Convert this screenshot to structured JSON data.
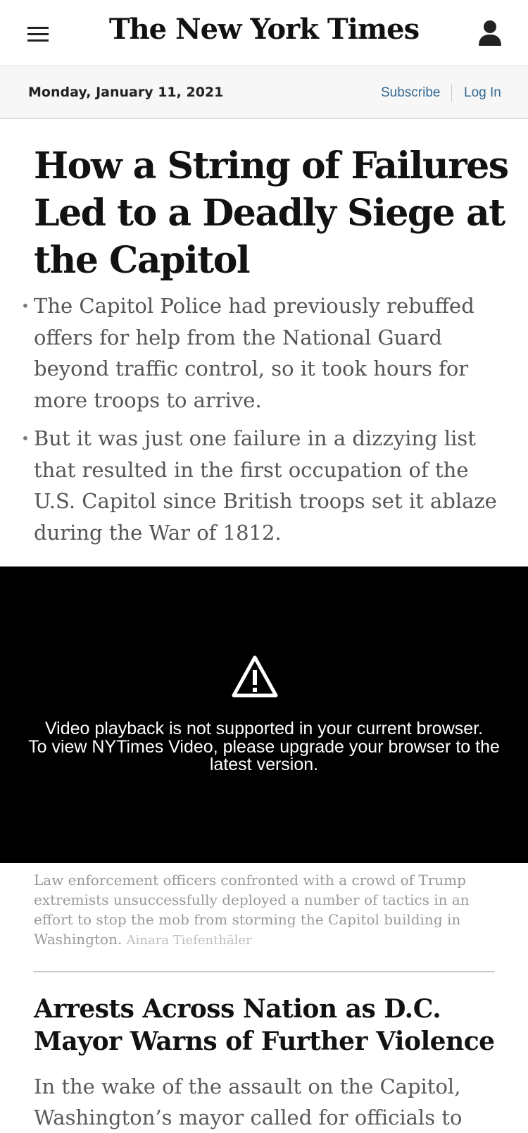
{
  "header": {
    "logo_text": "The New York Times",
    "menu_icon": "hamburger-menu-icon",
    "account_icon": "user-icon"
  },
  "datebar": {
    "date": "Monday, January 11, 2021",
    "subscribe_label": "Subscribe",
    "login_label": "Log In",
    "link_color": "#326891"
  },
  "lead_story": {
    "headline": "How a String of Failures Led to a Deadly Siege at the Capitol",
    "bullets": [
      "The Capitol Police had previously rebuffed offers for help from the National Guard beyond traffic control, so it took hours for more troops to arrive.",
      "But it was just one failure in a dizzying list that resulted in the first occupation of the U.S. Capitol since British troops set it ablaze during the War of 1812."
    ]
  },
  "video": {
    "icon": "warning-icon",
    "message_lines": [
      "Video playback is not supported in your current browser.",
      "To view NYTimes Video, please upgrade your browser to the",
      "latest version."
    ],
    "caption": "Law enforcement officers confronted with a crowd of Trump extremists unsuccessfully deployed a number of tactics in an effort to stop the mob from storming the Capitol building in Washington.",
    "credit": "Ainara Tiefenthäler"
  },
  "second_story": {
    "headline": "Arrests Across Nation as D.C. Mayor Warns of Further Violence",
    "summary": "In the wake of the assault on the Capitol, Washington’s mayor called for officials to"
  }
}
